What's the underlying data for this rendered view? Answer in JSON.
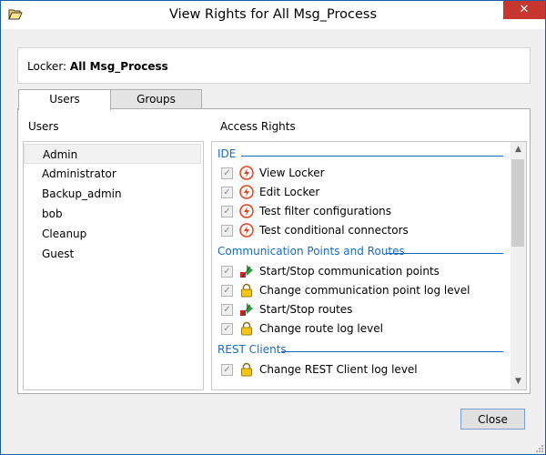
{
  "window": {
    "title": "View Rights for All Msg_Process",
    "close_glyph": "✕",
    "icon": "folder-open-icon"
  },
  "locker": {
    "label": "Locker:",
    "name": "All Msg_Process"
  },
  "tabs": [
    {
      "label": "Users",
      "selected": true
    },
    {
      "label": "Groups",
      "selected": false
    }
  ],
  "users_panel": {
    "header": "Users",
    "items": [
      {
        "label": "Admin",
        "selected": true
      },
      {
        "label": "Administrator",
        "selected": false
      },
      {
        "label": "Backup_admin",
        "selected": false
      },
      {
        "label": "bob",
        "selected": false
      },
      {
        "label": "Cleanup",
        "selected": false
      },
      {
        "label": "Guest",
        "selected": false
      }
    ]
  },
  "rights_panel": {
    "header": "Access Rights",
    "sections": [
      {
        "title": "IDE",
        "items": [
          {
            "label": "View Locker",
            "checked": true,
            "icon": "lightning-icon"
          },
          {
            "label": "Edit Locker",
            "checked": true,
            "icon": "lightning-icon"
          },
          {
            "label": "Test filter configurations",
            "checked": true,
            "icon": "lightning-icon"
          },
          {
            "label": "Test conditional connectors",
            "checked": true,
            "icon": "lightning-icon"
          }
        ]
      },
      {
        "title": "Communication Points and Routes",
        "items": [
          {
            "label": "Start/Stop communication points",
            "checked": true,
            "icon": "start-stop-icon"
          },
          {
            "label": "Change communication point log level",
            "checked": true,
            "icon": "lock-icon"
          },
          {
            "label": "Start/Stop routes",
            "checked": true,
            "icon": "start-stop-icon"
          },
          {
            "label": "Change route log level",
            "checked": true,
            "icon": "lock-icon"
          }
        ]
      },
      {
        "title": "REST Clients",
        "items": [
          {
            "label": "Change REST Client log level",
            "checked": true,
            "icon": "lock-icon"
          }
        ]
      }
    ]
  },
  "footer": {
    "close_label": "Close"
  },
  "colors": {
    "section_title": "#1a6bbd",
    "close_button_border": "#7a9ed1",
    "window_close": "#c7372f"
  }
}
